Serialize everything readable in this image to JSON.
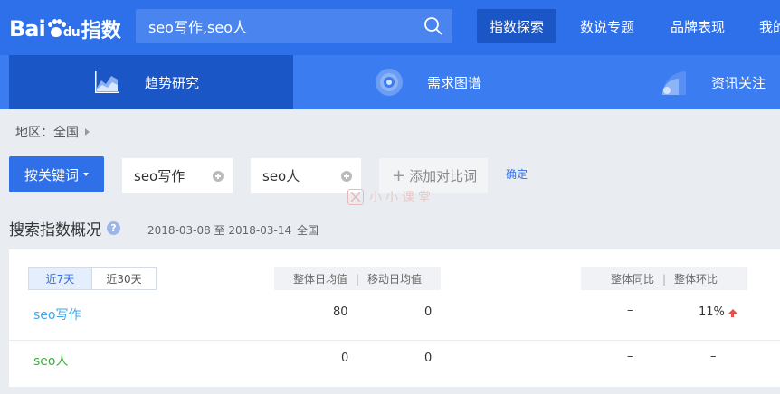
{
  "header": {
    "logo_text_a": "Bai",
    "logo_text_b": "du",
    "logo_sub": "指数",
    "search_value": "seo写作,seo人",
    "nav": [
      "指数探索",
      "数说专题",
      "品牌表现",
      "我的"
    ]
  },
  "subnav": {
    "tabs": [
      "趋势研究",
      "需求图谱",
      "资讯关注"
    ]
  },
  "region": {
    "label": "地区：",
    "value": "全国"
  },
  "keywords": {
    "by_keyword_button": "按关键词",
    "items": [
      "seo写作",
      "seo人"
    ],
    "add_compare": "添加对比词",
    "confirm": "确定"
  },
  "watermark": "小小课堂",
  "overview": {
    "title": "搜索指数概况",
    "help": "?",
    "date_range": "2018-03-08 至 2018-03-14",
    "area": "全国"
  },
  "panel": {
    "ranges": [
      "近7天",
      "近30天"
    ],
    "header_avg": [
      "整体日均值",
      "移动日均值"
    ],
    "header_compare": [
      "整体同比",
      "整体环比"
    ],
    "rows": [
      {
        "keyword": "seo写作",
        "overall_avg": "80",
        "mobile_avg": "0",
        "yoy": "–",
        "mom": "11%",
        "color": "#41a5e6"
      },
      {
        "keyword": "seo人",
        "overall_avg": "0",
        "mobile_avg": "0",
        "yoy": "–",
        "mom": "–",
        "color": "#3cae3a"
      }
    ]
  },
  "colors": {
    "header_bg": "#2e6fea",
    "subnav_bg": "#3b7cf0",
    "active_bg": "#1b56c6",
    "accent": "#2f6fe8",
    "up": "#e2524a"
  }
}
